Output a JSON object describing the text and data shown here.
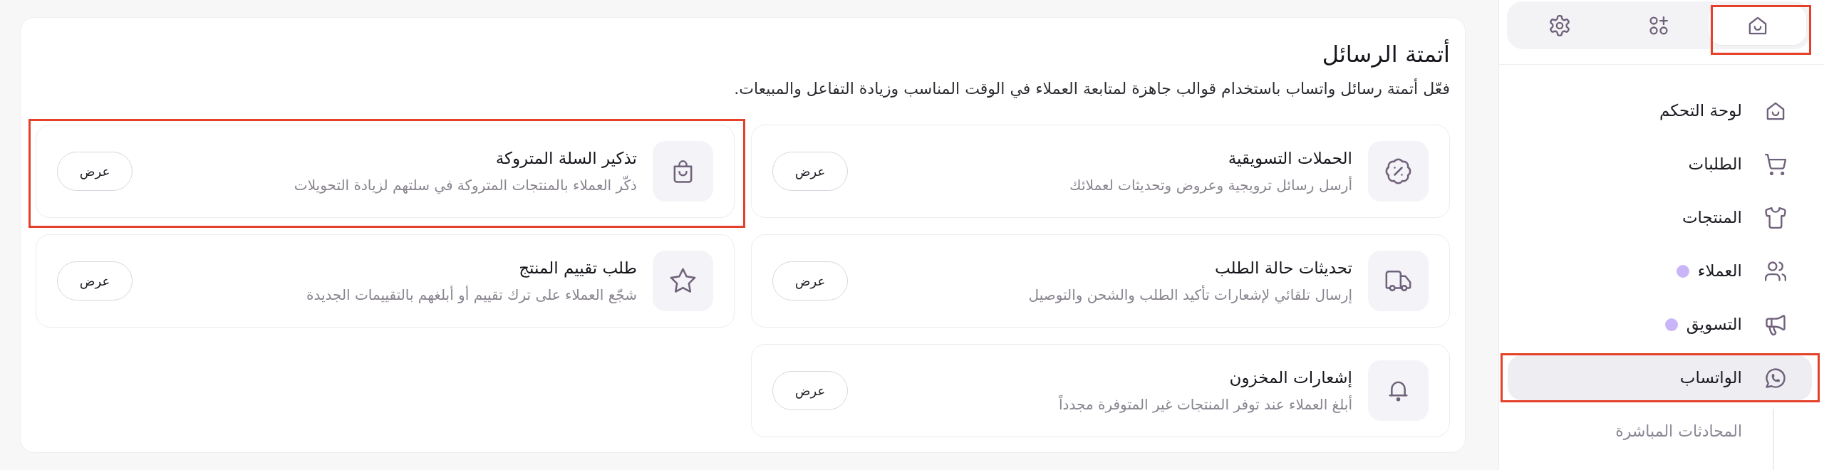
{
  "sidebar": {
    "tabs": [
      {
        "kind": "home",
        "selected": true,
        "highlighted": true
      },
      {
        "kind": "apps",
        "selected": false,
        "highlighted": false
      },
      {
        "kind": "settings",
        "selected": false,
        "highlighted": false
      }
    ],
    "nav": [
      {
        "kind": "home",
        "label": "لوحة التحكم",
        "selected": false,
        "highlighted": false
      },
      {
        "kind": "cart",
        "label": "الطلبات",
        "selected": false,
        "highlighted": false
      },
      {
        "kind": "shirt",
        "label": "المنتجات",
        "selected": false,
        "highlighted": false
      },
      {
        "kind": "users",
        "label": "العملاء",
        "selected": false,
        "highlighted": false,
        "color": "#c9b5f7"
      },
      {
        "kind": "megaphone",
        "label": "التسويق",
        "selected": false,
        "highlighted": false,
        "color": "#c9b5f7"
      },
      {
        "kind": "whatsapp",
        "label": "الواتساب",
        "selected": true,
        "highlighted": true,
        "children": [
          {
            "label": "المحادثات المباشرة",
            "selected": false
          }
        ]
      }
    ]
  },
  "main": {
    "title": "أتمتة الرسائل",
    "subtitle": "فعّل أتمتة رسائل واتساب باستخدام قوالب جاهزة لمتابعة العملاء في الوقت المناسب وزيادة التفاعل والمبيعات.",
    "cards": [
      {
        "kind": "percent",
        "title": "الحملات التسويقية",
        "description": "أرسل رسائل ترويجية وعروض وتحديثات لعملائك",
        "button": "عرض",
        "highlighted": false
      },
      {
        "kind": "bag",
        "title": "تذكير السلة المتروكة",
        "description": "ذكّر العملاء بالمنتجات المتروكة في سلتهم لزيادة التحويلات",
        "button": "عرض",
        "highlighted": true
      },
      {
        "kind": "truck",
        "title": "تحديثات حالة الطلب",
        "description": "إرسال تلقائي لإشعارات تأكيد الطلب والشحن والتوصيل",
        "button": "عرض",
        "highlighted": false
      },
      {
        "kind": "star",
        "title": "طلب تقييم المنتج",
        "description": "شجّع العملاء على ترك تقييم أو أبلغهم بالتقييمات الجديدة",
        "button": "عرض",
        "highlighted": false
      },
      {
        "kind": "bell",
        "title": "إشعارات المخزون",
        "description": "أبلغ العملاء عند توفر المنتجات غير المتوفرة مجدداً",
        "button": "عرض",
        "highlighted": false
      }
    ]
  }
}
